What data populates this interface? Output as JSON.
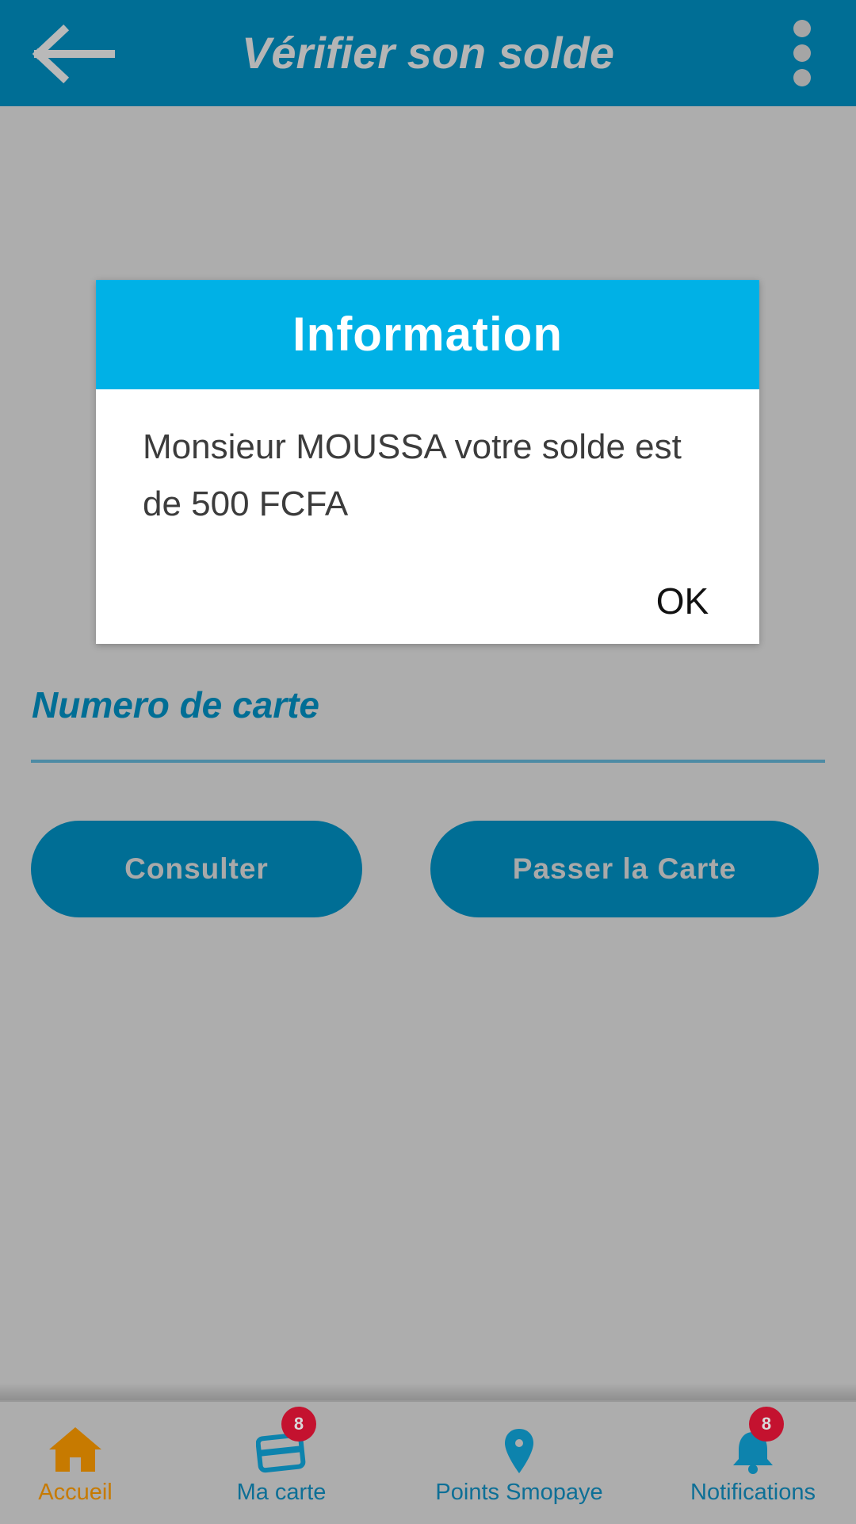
{
  "app_bar": {
    "title": "Vérifier son solde",
    "back_icon": "arrow-left-icon",
    "menu_icon": "more-vertical-icon"
  },
  "form": {
    "card_number_label": "Numero de carte",
    "consult_button": "Consulter",
    "swipe_card_button": "Passer la Carte"
  },
  "dialog": {
    "title": "Information",
    "message": "Monsieur MOUSSA votre solde est de 500 FCFA",
    "ok_button": "OK"
  },
  "bottom_nav": {
    "items": [
      {
        "label": "Accueil",
        "icon": "home-icon",
        "active": true,
        "badge": null
      },
      {
        "label": "Ma carte",
        "icon": "card-icon",
        "active": false,
        "badge": "8"
      },
      {
        "label": "Points Smopaye",
        "icon": "map-pin-icon",
        "active": false,
        "badge": null
      },
      {
        "label": "Notifications",
        "icon": "bell-icon",
        "active": false,
        "badge": "8"
      }
    ]
  },
  "colors": {
    "primary": "#006e95",
    "dialog_header": "#00b1e6",
    "active_nav": "#c77a00",
    "badge": "#c4122f",
    "overlay_background": "#adadad"
  }
}
